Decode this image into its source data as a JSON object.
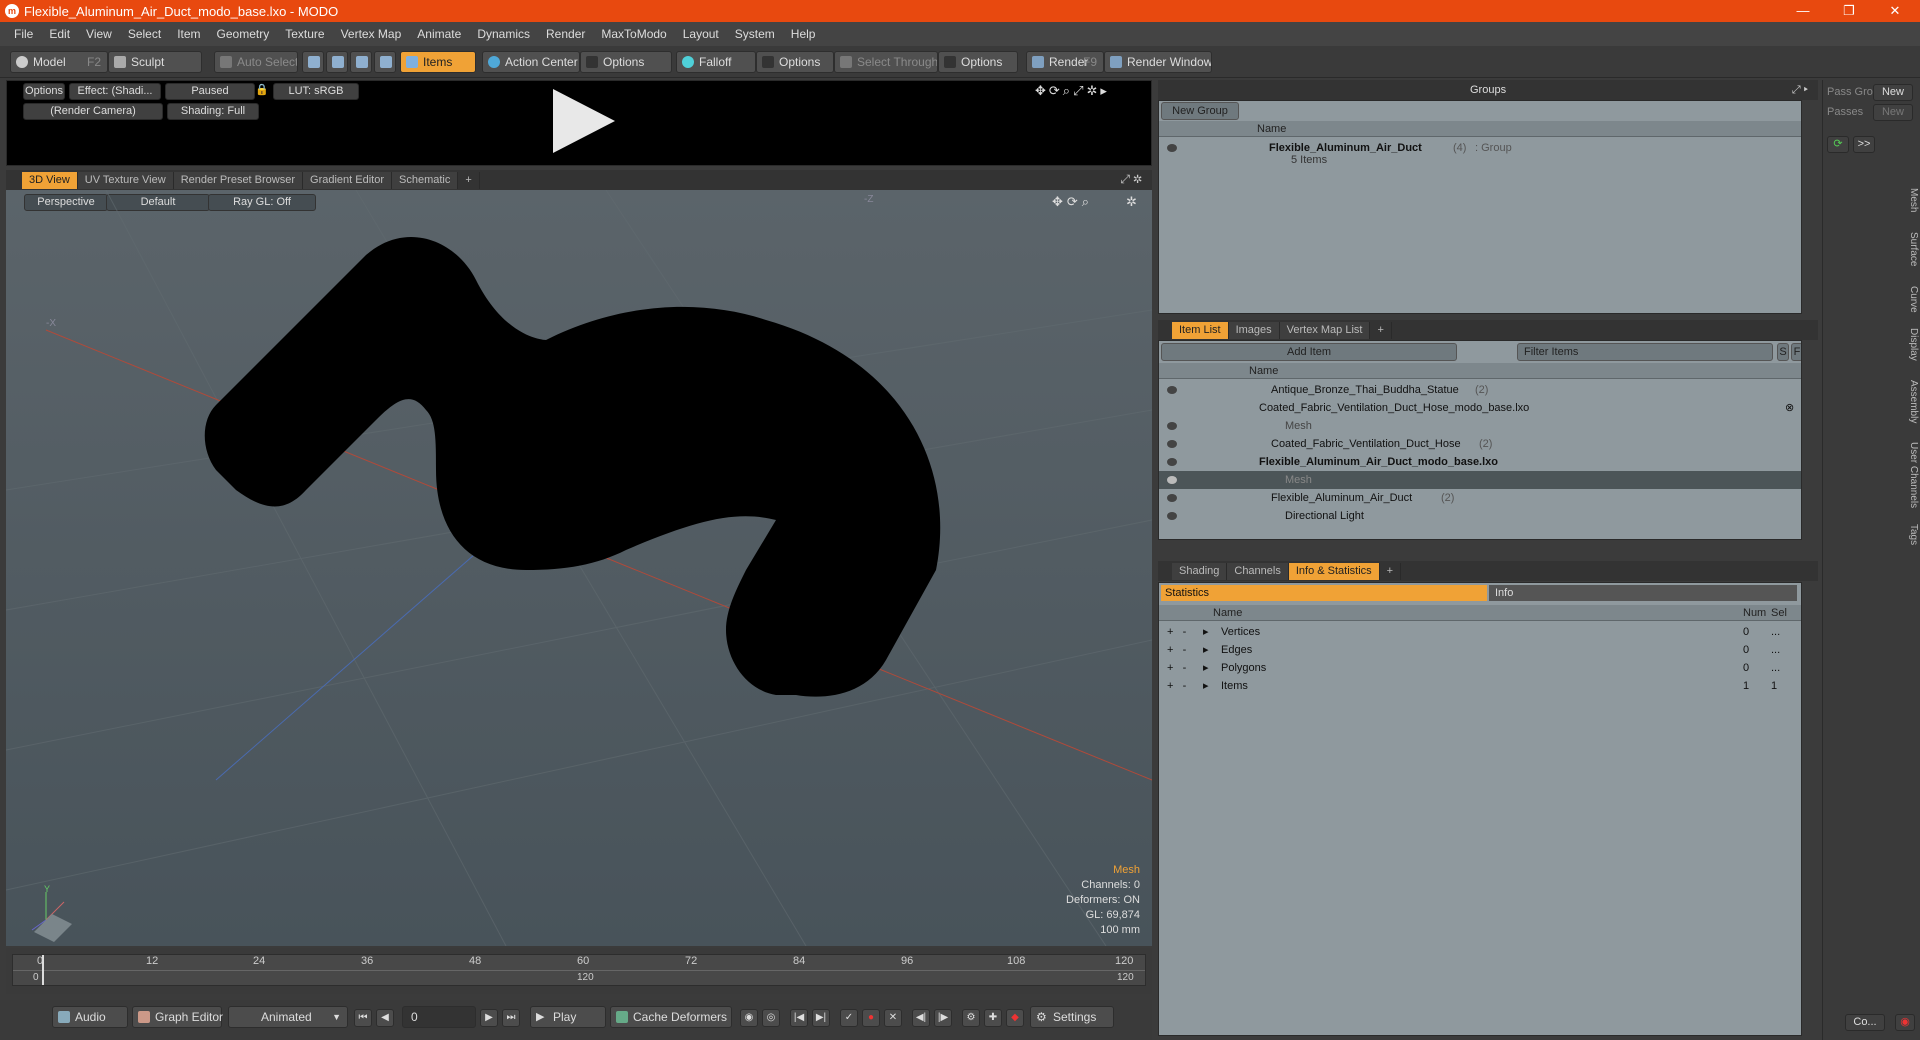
{
  "window": {
    "title": "Flexible_Aluminum_Air_Duct_modo_base.lxo - MODO",
    "minimize": "—",
    "maximize": "❐",
    "close": "✕"
  },
  "menu": [
    "File",
    "Edit",
    "View",
    "Select",
    "Item",
    "Geometry",
    "Texture",
    "Vertex Map",
    "Animate",
    "Dynamics",
    "Render",
    "MaxToModo",
    "Layout",
    "System",
    "Help"
  ],
  "toolbar": {
    "model": "Model",
    "model_key": "F2",
    "sculpt": "Sculpt",
    "auto_select": "Auto Select",
    "items": "Items",
    "action_center": "Action Center",
    "options1": "Options",
    "falloff": "Falloff",
    "options2": "Options",
    "select_through": "Select Through",
    "options3": "Options",
    "render": "Render",
    "render_key": "F9",
    "render_window": "Render Window"
  },
  "preview": {
    "options": "Options",
    "effect": "Effect: (Shadi...",
    "paused": "Paused",
    "lut": "LUT: sRGB",
    "camera": "(Render Camera)",
    "shading": "Shading: Full"
  },
  "viewtabs": [
    "3D View",
    "UV Texture View",
    "Render Preset Browser",
    "Gradient Editor",
    "Schematic",
    "+"
  ],
  "viewport": {
    "projection": "Perspective",
    "style": "Default",
    "raygl": "Ray GL: Off",
    "axis_x": "-X",
    "axis_z": "-Z",
    "axis_y": "Y",
    "info_title": "Mesh",
    "channels": "Channels: 0",
    "deformers": "Deformers: ON",
    "gl": "GL: 69,874",
    "scale": "100 mm"
  },
  "timeline": {
    "ticks": [
      "0",
      "12",
      "24",
      "36",
      "48",
      "60",
      "72",
      "84",
      "96",
      "108",
      "120"
    ],
    "bottom_ticks": [
      "0",
      "120",
      "120"
    ]
  },
  "bottombar": {
    "audio": "Audio",
    "graph_editor": "Graph Editor",
    "animated": "Animated",
    "frame": "0",
    "play": "Play",
    "cache": "Cache Deformers",
    "settings": "Settings"
  },
  "groups": {
    "title": "Groups",
    "new_group": "New Group",
    "col_name": "Name",
    "item_name": "Flexible_Aluminum_Air_Duct",
    "item_count": "(4)",
    "item_type": ": Group",
    "item_sub": "5 Items"
  },
  "passes": {
    "pass_label": "Pass Gro",
    "new1": "New",
    "passes_label": "Passes",
    "new2": "New",
    "arrow": ">>"
  },
  "itemlist": {
    "tabs": [
      "Item List",
      "Images",
      "Vertex Map List",
      "+"
    ],
    "add_item": "Add Item",
    "filter": "Filter Items",
    "s": "S",
    "f": "F",
    "col_name": "Name",
    "rows": [
      {
        "name": "Antique_Bronze_Thai_Buddha_Statue",
        "count": "(2)"
      },
      {
        "name": "Coated_Fabric_Ventilation_Duct_Hose_modo_base.lxo",
        "count": ""
      },
      {
        "name": "Mesh",
        "count": ""
      },
      {
        "name": "Coated_Fabric_Ventilation_Duct_Hose",
        "count": "(2)"
      },
      {
        "name": "Flexible_Aluminum_Air_Duct_modo_base.lxo",
        "count": ""
      },
      {
        "name": "Mesh",
        "count": ""
      },
      {
        "name": "Flexible_Aluminum_Air_Duct",
        "count": "(2)"
      },
      {
        "name": "Directional Light",
        "count": ""
      }
    ]
  },
  "stats": {
    "tabs": [
      "Shading",
      "Channels",
      "Info & Statistics",
      "+"
    ],
    "statistics": "Statistics",
    "info": "Info",
    "col_name": "Name",
    "col_num": "Num",
    "col_sel": "Sel",
    "rows": [
      {
        "name": "Vertices",
        "num": "0",
        "sel": "..."
      },
      {
        "name": "Edges",
        "num": "0",
        "sel": "..."
      },
      {
        "name": "Polygons",
        "num": "0",
        "sel": "..."
      },
      {
        "name": "Items",
        "num": "1",
        "sel": "1"
      }
    ]
  },
  "sidetabs": [
    "Mesh",
    "Surface",
    "Curve",
    "Display",
    "Assembly",
    "User Channels",
    "Tags"
  ],
  "corner": {
    "co": "Co..."
  }
}
